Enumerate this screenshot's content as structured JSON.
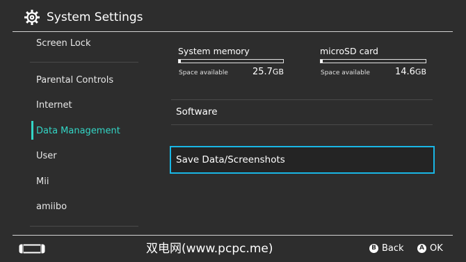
{
  "header": {
    "title": "System Settings",
    "icon": "gear-icon"
  },
  "sidebar": {
    "items": [
      {
        "label": "Screen Lock"
      },
      {
        "label": "Parental Controls"
      },
      {
        "label": "Internet"
      },
      {
        "label": "Data Management",
        "selected": true
      },
      {
        "label": "User"
      },
      {
        "label": "Mii"
      },
      {
        "label": "amiibo"
      }
    ]
  },
  "storage": {
    "system": {
      "title": "System memory",
      "label": "Space available",
      "value": "25.7",
      "unit": "GB",
      "used_fraction": 0.01
    },
    "sd": {
      "title": "microSD card",
      "label": "Space available",
      "value": "14.6",
      "unit": "GB",
      "used_fraction": 0.02
    }
  },
  "menu": {
    "items": [
      {
        "label": "Software"
      },
      {
        "label": "Save Data/Screenshots",
        "selected": true
      }
    ]
  },
  "footer": {
    "console_icon": "handheld-console-icon",
    "watermark": "双电网(www.pcpc.me)",
    "back": {
      "key": "B",
      "label": "Back"
    },
    "ok": {
      "key": "A",
      "label": "OK"
    }
  },
  "colors": {
    "accent": "#33d6c6",
    "focus": "#19b7e6",
    "background": "#2d2d2d"
  }
}
